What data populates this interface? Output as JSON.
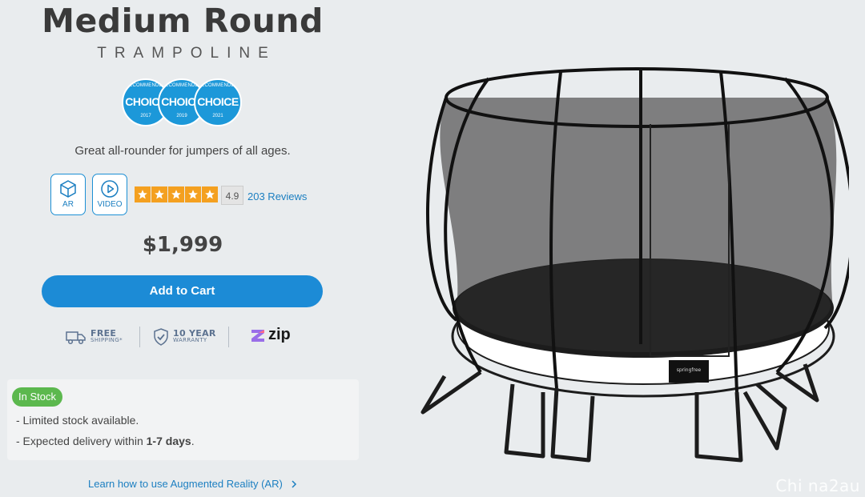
{
  "product": {
    "title": "Medium Round",
    "subtitle": "TRAMPOLINE",
    "tagline": "Great all-rounder for jumpers of all ages.",
    "price": "$1,999",
    "add_to_cart_label": "Add to Cart",
    "brand_mark": "springfree"
  },
  "awards": [
    {
      "arc": "RECOMMENDED",
      "label": "CHOICE",
      "year": "2017"
    },
    {
      "arc": "RECOMMENDED",
      "label": "CHOICE",
      "year": "2019"
    },
    {
      "arc": "RECOMMENDED",
      "label": "CHOICE",
      "year": "2021"
    }
  ],
  "media_buttons": {
    "ar_label": "AR",
    "video_label": "VIDEO"
  },
  "rating": {
    "stars": 5,
    "score": "4.9",
    "reviews_label": "203 Reviews"
  },
  "perks": {
    "shipping_title": "FREE",
    "shipping_sub": "SHIPPING*",
    "warranty_title": "10 YEAR",
    "warranty_sub": "WARRANTY",
    "payment_label": "zip"
  },
  "stock": {
    "badge": "In Stock",
    "line1": "- Limited stock available.",
    "line2_prefix": "- Expected delivery within ",
    "line2_bold": "1-7 days",
    "line2_suffix": "."
  },
  "ar_link": {
    "label": "Learn how to use Augmented Reality (AR)"
  },
  "watermark": "Chi na2au",
  "colors": {
    "accent": "#1c8bd6",
    "star": "#f4a020",
    "in_stock": "#5cb84e",
    "background": "#e9ecee",
    "badge_blue": "#1c98d9"
  },
  "icons": [
    "ar-cube-icon",
    "play-icon",
    "star-icon",
    "truck-icon",
    "shield-check-icon",
    "zip-logo-icon",
    "chevron-right-icon"
  ]
}
